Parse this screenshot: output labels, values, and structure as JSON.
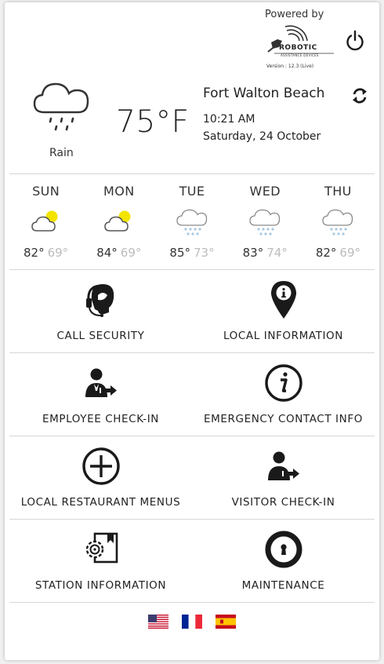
{
  "header": {
    "powered_by": "Powered by",
    "logo_name": "ROBOTIC",
    "logo_sub": "ASSISTANCE DEVICES",
    "version": "Version : 12.3 (Live)",
    "power_icon": "power-icon"
  },
  "current_weather": {
    "condition": "Rain",
    "temperature": "75°F",
    "city": "Fort Walton Beach",
    "time": "10:21 AM",
    "date": "Saturday, 24 October",
    "refresh_icon": "refresh-icon"
  },
  "forecast": [
    {
      "day": "SUN",
      "icon": "partly-sunny-icon",
      "high": "82°",
      "low": "69°"
    },
    {
      "day": "MON",
      "icon": "partly-sunny-icon",
      "high": "84°",
      "low": "69°"
    },
    {
      "day": "TUE",
      "icon": "rain-icon",
      "high": "85°",
      "low": "73°"
    },
    {
      "day": "WED",
      "icon": "rain-icon",
      "high": "83°",
      "low": "74°"
    },
    {
      "day": "THU",
      "icon": "rain-icon",
      "high": "82°",
      "low": "69°"
    }
  ],
  "menu": [
    {
      "label": "CALL SECURITY",
      "icon": "headset-agent-icon"
    },
    {
      "label": "LOCAL INFORMATION",
      "icon": "info-pin-icon"
    },
    {
      "label": "EMPLOYEE CHECK-IN",
      "icon": "employee-check-in-icon"
    },
    {
      "label": "EMERGENCY CONTACT INFO",
      "icon": "info-circle-icon"
    },
    {
      "label": "LOCAL RESTAURANT MENUS",
      "icon": "plus-circle-icon"
    },
    {
      "label": "VISITOR CHECK-IN",
      "icon": "visitor-check-in-icon"
    },
    {
      "label": "STATION INFORMATION",
      "icon": "station-gear-icon"
    },
    {
      "label": "MAINTENANCE",
      "icon": "keyhole-icon"
    }
  ],
  "languages": [
    {
      "name": "us-flag-icon"
    },
    {
      "name": "france-flag-icon"
    },
    {
      "name": "spain-flag-icon"
    }
  ],
  "colors": {
    "sun": "#f2e400",
    "rain_drops": "#a8c8e0",
    "low_temp": "#bcbcbc",
    "icon_dark": "#1a1a1a"
  }
}
